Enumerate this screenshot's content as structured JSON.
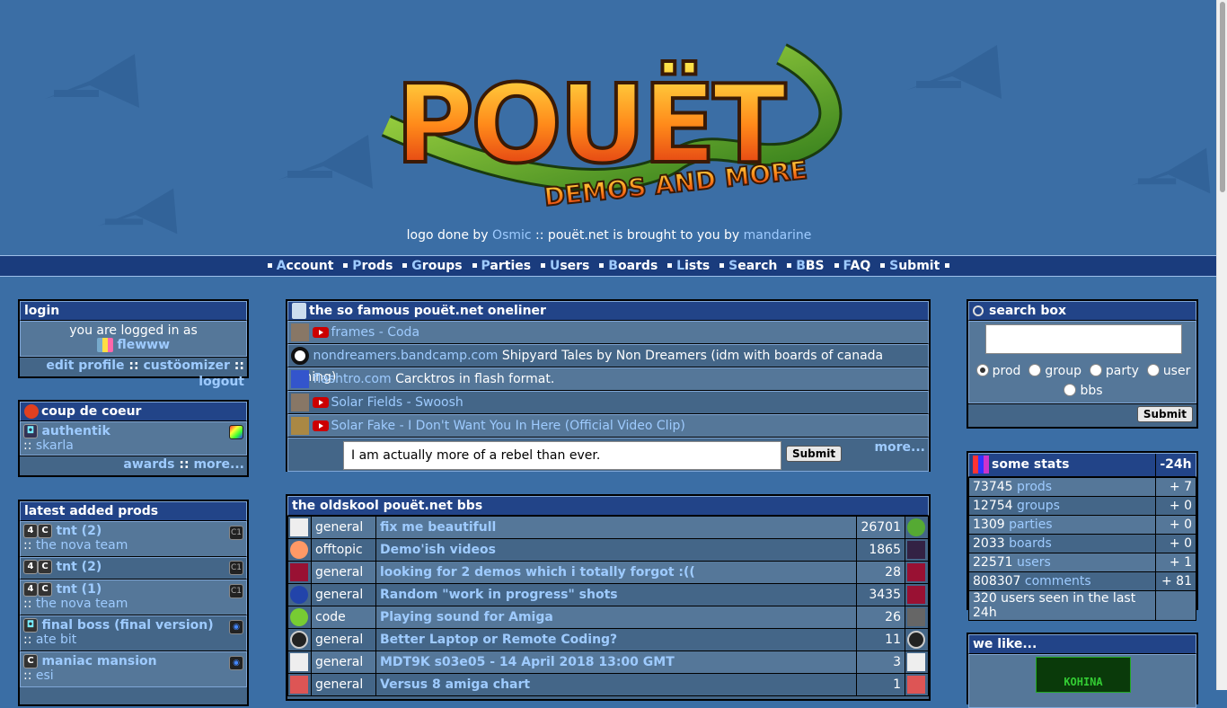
{
  "header": {
    "credit_prefix": "logo done by ",
    "credit_artist": "Osmic",
    "credit_middle": " :: pouët.net is brought to you by ",
    "credit_host": "mandarine",
    "logo_text": "POUËT",
    "logo_tagline": "DEMOS AND MORE"
  },
  "nav": {
    "items": [
      {
        "first": "A",
        "rest": "ccount"
      },
      {
        "first": "P",
        "rest": "rods"
      },
      {
        "first": "G",
        "rest": "roups"
      },
      {
        "first": "P",
        "rest": "arties"
      },
      {
        "first": "U",
        "rest": "sers"
      },
      {
        "first": "B",
        "rest": "oards"
      },
      {
        "first": "L",
        "rest": "ists"
      },
      {
        "first": "S",
        "rest": "earch"
      },
      {
        "first": "B",
        "rest": "BS"
      },
      {
        "first": "F",
        "rest": "AQ"
      },
      {
        "first": "S",
        "rest": "ubmit"
      }
    ]
  },
  "login": {
    "title": "login",
    "logged_in_text": "you are logged in as",
    "username": "flewww",
    "edit_profile": "edit profile",
    "customizer": "custöomizer",
    "logout": "logout",
    "sep": "::"
  },
  "coup": {
    "title": "coup de coeur",
    "prod": "authentik",
    "group": "skarla",
    "group_prefix": ":: ",
    "awards": "awards",
    "more": "more..."
  },
  "latest": {
    "title": "latest added prods",
    "items": [
      {
        "name": "tnt (2)",
        "group": "the nova team"
      },
      {
        "name": "tnt (2)",
        "group": ""
      },
      {
        "name": "tnt (1)",
        "group": "the nova team"
      },
      {
        "name": "final boss (final version)",
        "group": "ate bit"
      },
      {
        "name": "maniac mansion",
        "group": "esi"
      }
    ]
  },
  "oneliner": {
    "title": "the so famous pouët.net oneliner",
    "lines": [
      {
        "link": "frames - Coda",
        "text": ""
      },
      {
        "link": "nondreamers.bandcamp.com",
        "text": " Shipyard Tales by Non Dreamers (idm with boards of canada tuning)"
      },
      {
        "link": "flashtro.com",
        "text": " Carcktros in flash format."
      },
      {
        "link": "Solar Fields - Swoosh",
        "text": ""
      },
      {
        "link": "Solar Fake - I Don't Want You In Here (Official Video Clip)",
        "text": ""
      }
    ],
    "input_value": "I am actually more of a rebel than ever.",
    "submit": "Submit",
    "more": "more..."
  },
  "bbs": {
    "title": "the oldskool pouët.net bbs",
    "rows": [
      {
        "cat": "general",
        "topic": "fix me beautifull",
        "count": "26701"
      },
      {
        "cat": "offtopic",
        "topic": "Demo'ish videos",
        "count": "1865"
      },
      {
        "cat": "general",
        "topic": "looking for 2 demos which i totally forgot :((",
        "count": "28"
      },
      {
        "cat": "general",
        "topic": "Random \"work in progress\" shots",
        "count": "3435"
      },
      {
        "cat": "code",
        "topic": "Playing sound for Amiga",
        "count": "26"
      },
      {
        "cat": "general",
        "topic": "Better Laptop or Remote Coding?",
        "count": "11"
      },
      {
        "cat": "general",
        "topic": "MDT9K s03e05 - 14 April 2018 13:00 GMT",
        "count": "3"
      },
      {
        "cat": "general",
        "topic": "Versus 8 amiga chart",
        "count": "1"
      }
    ]
  },
  "search": {
    "title": "search box",
    "options": [
      "prod",
      "group",
      "party",
      "user",
      "bbs"
    ],
    "submit": "Submit"
  },
  "stats": {
    "title": "some stats",
    "period": "-24h",
    "rows": [
      {
        "num": "73745",
        "label": "prods",
        "delta": "+ 7"
      },
      {
        "num": "12754",
        "label": "groups",
        "delta": "+ 0"
      },
      {
        "num": "1309",
        "label": "parties",
        "delta": "+ 0"
      },
      {
        "num": "2033",
        "label": "boards",
        "delta": "+ 0"
      },
      {
        "num": "22571",
        "label": "users",
        "delta": "+ 1"
      },
      {
        "num": "808307",
        "label": "comments",
        "delta": "+ 81"
      }
    ],
    "seen": "320 users seen in the last 24h"
  },
  "welike": {
    "title": "we like...",
    "banner": "KOHINA"
  },
  "colors": {
    "background": "#3b6ea5",
    "navbar": "#1a3c7d",
    "box_title": "#224488",
    "link": "#9ecbff"
  }
}
